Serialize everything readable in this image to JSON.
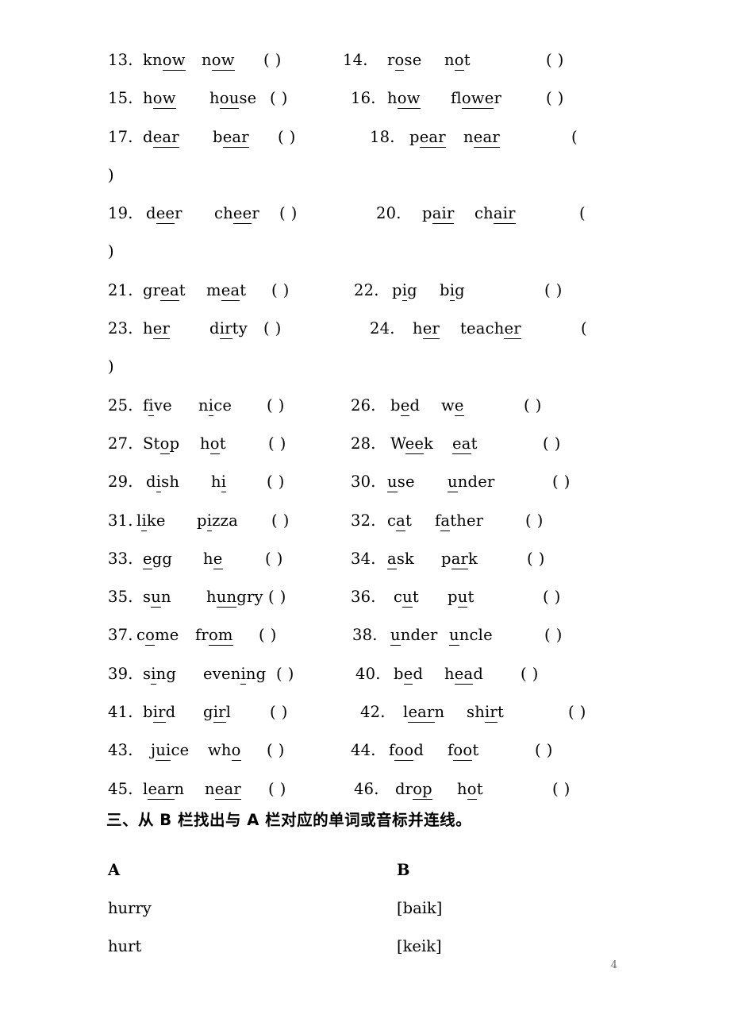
{
  "document": {
    "page_number": "4"
  },
  "exercise_rows": [
    {
      "left": {
        "num": "13.",
        "w1": [
          "kn",
          "ow",
          ""
        ],
        "w2": [
          "n",
          "ow",
          ""
        ],
        "paren": "(    )"
      },
      "right": {
        "num": "14.",
        "w1": [
          "r",
          "o",
          "se"
        ],
        "w2": [
          "n",
          "o",
          "t"
        ],
        "paren": "(    )"
      }
    },
    {
      "left": {
        "num": "15.",
        "w1": [
          "h",
          "ow",
          ""
        ],
        "w2": [
          "h",
          "ou",
          "se"
        ],
        "paren": "(    )"
      },
      "right": {
        "num": "16.",
        "w1": [
          "h",
          "ow",
          ""
        ],
        "w2": [
          "fl",
          "owe",
          "r"
        ],
        "paren": "(    )"
      }
    },
    {
      "left": {
        "num": "17.",
        "w1": [
          "d",
          "ear",
          ""
        ],
        "w2": [
          "b",
          "ear",
          ""
        ],
        "paren": "(    )"
      },
      "right": {
        "num": "18.",
        "w1": [
          "p",
          "ear",
          ""
        ],
        "w2": [
          "n",
          "ear",
          ""
        ],
        "paren": "(",
        "hang": ")"
      }
    },
    {
      "left": {
        "num": "19.",
        "w1": [
          "d",
          "ee",
          "r"
        ],
        "w2": [
          "ch",
          "ee",
          "r"
        ],
        "paren": "(    )"
      },
      "right": {
        "num": "20.",
        "w1": [
          "p",
          "air",
          ""
        ],
        "w2": [
          "ch",
          "air ",
          ""
        ],
        "paren": "(",
        "hang": ")"
      }
    },
    {
      "left": {
        "num": "21.",
        "w1": [
          "gr",
          "ea",
          "t"
        ],
        "w2": [
          "m",
          "ea",
          "t"
        ],
        "paren": "(    )"
      },
      "right": {
        "num": "22.",
        "w1": [
          "p",
          "i",
          "g"
        ],
        "w2": [
          "b",
          "i",
          "g"
        ],
        "paren": "(    )"
      }
    },
    {
      "left": {
        "num": "23.",
        "w1": [
          "h",
          "er",
          ""
        ],
        "w2": [
          "d",
          "ir",
          "ty"
        ],
        "paren": "(    )"
      },
      "right": {
        "num": "24.",
        "w1": [
          "h",
          "er",
          ""
        ],
        "w2": [
          "teach",
          "er",
          ""
        ],
        "paren": "(",
        "hang": ")"
      }
    },
    {
      "left": {
        "num": "25.",
        "w1": [
          "f",
          "i",
          "ve"
        ],
        "w2": [
          "n",
          "i",
          "ce"
        ],
        "paren": "(    )"
      },
      "right": {
        "num": "26.",
        "w1": [
          "b",
          "e",
          "d"
        ],
        "w2": [
          "w",
          "e ",
          ""
        ],
        "paren": "(    )"
      }
    },
    {
      "left": {
        "num": "27.",
        "w1": [
          "St",
          "o",
          "p"
        ],
        "w2": [
          "h",
          "o",
          "t"
        ],
        "paren": "(    )"
      },
      "right": {
        "num": "28.",
        "w1": [
          "W",
          "ee",
          "k"
        ],
        "w2": [
          "",
          "ea",
          "t"
        ],
        "paren": "(    )"
      }
    },
    {
      "left": {
        "num": "29.",
        "w1": [
          "d",
          "i",
          "sh"
        ],
        "w2": [
          "h",
          "i",
          ""
        ],
        "paren": "(    )"
      },
      "right": {
        "num": "30.",
        "w1": [
          "",
          "u",
          "se"
        ],
        "w2": [
          "",
          "u",
          "nder"
        ],
        "paren": "(    )"
      }
    },
    {
      "left": {
        "num": "31.",
        "w1": [
          "l",
          "i",
          "ke"
        ],
        "w2": [
          "p",
          "i",
          "zza"
        ],
        "paren": "(    )"
      },
      "right": {
        "num": "32.",
        "w1": [
          "c",
          "a",
          "t"
        ],
        "w2": [
          "f",
          "a",
          "ther"
        ],
        "paren": "(    )"
      }
    },
    {
      "left": {
        "num": "33.",
        "w1": [
          "",
          "e",
          "gg"
        ],
        "w2": [
          "h",
          "e",
          ""
        ],
        "paren": "(    )"
      },
      "right": {
        "num": "34.",
        "w1": [
          "",
          "a",
          "sk"
        ],
        "w2": [
          "p",
          "ar",
          "k"
        ],
        "paren": "(    )"
      }
    },
    {
      "left": {
        "num": "35.",
        "w1": [
          "s",
          "u",
          "n"
        ],
        "w2": [
          "h",
          "un",
          "gry"
        ],
        "paren": "(    )"
      },
      "right": {
        "num": "36.",
        "w1": [
          "c",
          "u",
          "t"
        ],
        "w2": [
          "p",
          "u",
          "t"
        ],
        "paren": "(    )"
      }
    },
    {
      "left": {
        "num": "37.",
        "w1": [
          "c",
          "o",
          "me"
        ],
        "w2": [
          "fr",
          "om",
          ""
        ],
        "paren": "(    )"
      },
      "right": {
        "num": "38.",
        "w1": [
          "",
          "u",
          "nder"
        ],
        "w2": [
          "",
          "u",
          "ncle"
        ],
        "paren": "(    )"
      }
    },
    {
      "left": {
        "num": "39.",
        "w1": [
          "s",
          "i",
          "ng"
        ],
        "w2": [
          "even",
          "i",
          "ng"
        ],
        "paren": "(    )"
      },
      "right": {
        "num": "40.",
        "w1": [
          "b",
          "e",
          "d"
        ],
        "w2": [
          "h",
          "ea",
          "d"
        ],
        "paren": "(    )"
      }
    },
    {
      "left": {
        "num": "41.",
        "w1": [
          "b",
          "ir",
          "d"
        ],
        "w2": [
          "g",
          "ir",
          "l"
        ],
        "paren": "(    )"
      },
      "right": {
        "num": "42.",
        "w1": [
          "l",
          "ear",
          "n"
        ],
        "w2": [
          "sh",
          "ir",
          "t"
        ],
        "paren": "(    )"
      }
    },
    {
      "left": {
        "num": "43.",
        "w1": [
          "j",
          "ui",
          "ce"
        ],
        "w2": [
          "wh",
          "o",
          ""
        ],
        "paren": "(    )"
      },
      "right": {
        "num": "44.",
        "w1": [
          "f",
          "oo",
          "d"
        ],
        "w2": [
          "f",
          "oo",
          "t"
        ],
        "paren": "(    )"
      }
    },
    {
      "left": {
        "num": "45.",
        "w1": [
          "l",
          "ear",
          "n"
        ],
        "w2": [
          "n",
          "ear",
          ""
        ],
        "paren": "(    )"
      },
      "right": {
        "num": "46.",
        "w1": [
          "dr",
          "op",
          ""
        ],
        "w2": [
          "h",
          "o",
          "t"
        ],
        "paren": "(    )"
      }
    }
  ],
  "section_three": {
    "heading": "三、从 B 栏找出与 A 栏对应的单词或音标并连线。",
    "column_a_header": "A",
    "column_b_header": "B",
    "pairs": [
      {
        "a": "hurry",
        "b": "[baik]"
      },
      {
        "a": "hurt",
        "b": "[keik]"
      }
    ]
  }
}
